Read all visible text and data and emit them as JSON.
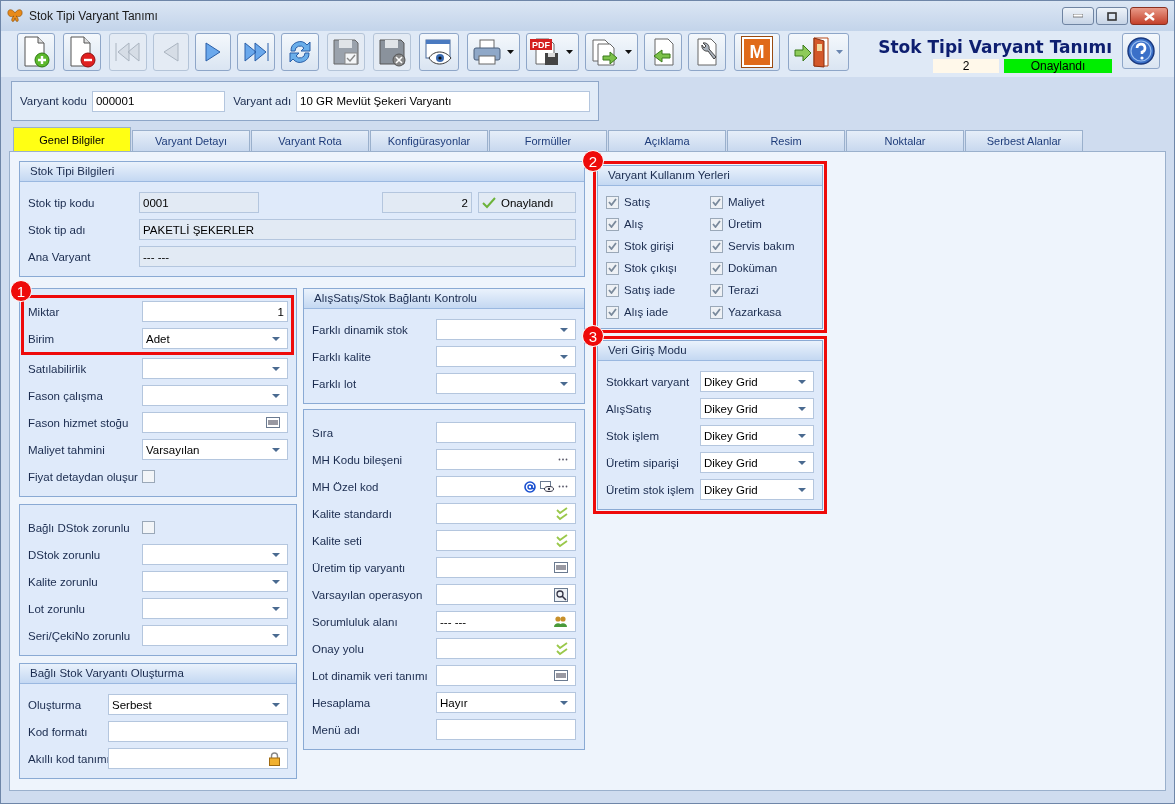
{
  "window": {
    "title": "Stok Tipi Varyant Tanımı"
  },
  "toolbar": [
    [
      {
        "disabled": false
      }
    ],
    [
      {
        "disabled": false
      }
    ],
    [
      {
        "disabled": true
      },
      {
        "disabled": true
      },
      {
        "disabled": false
      },
      {
        "disabled": false
      },
      {
        "disabled": false
      }
    ],
    [
      {
        "disabled": true
      }
    ],
    [
      {
        "disabled": true
      }
    ],
    [
      {
        "disabled": false
      }
    ],
    [
      {
        "disabled": false,
        "menu": true
      },
      {
        "label": "PDF",
        "disabled": false,
        "menu": true
      },
      {
        "disabled": false,
        "menu": true
      },
      {
        "disabled": false
      },
      {
        "disabled": false
      }
    ],
    [
      {
        "label": "M",
        "disabled": false
      }
    ],
    [
      {
        "disabled": false,
        "menu": true
      }
    ]
  ],
  "header": {
    "title": "Stok Tipi Varyant Tanımı",
    "number": "2",
    "status": "Onaylandı",
    "approved": true
  },
  "variant": {
    "code_label": "Varyant kodu",
    "code": "000001",
    "name_label": "Varyant adı",
    "name": "10 GR Mevlüt Şekeri Varyantı"
  },
  "tabs": [
    {
      "label": "Genel Bilgiler",
      "selected": true
    },
    {
      "label": "Varyant Detayı",
      "selected": false
    },
    {
      "label": "Varyant Rota",
      "selected": false
    },
    {
      "label": "Konfigürasyonlar",
      "selected": false
    },
    {
      "label": "Formüller",
      "selected": false
    },
    {
      "label": "Açıklama",
      "selected": false
    },
    {
      "label": "Resim",
      "selected": false
    },
    {
      "label": "Noktalar",
      "selected": false
    },
    {
      "label": "Serbest Alanlar",
      "selected": false
    }
  ],
  "stock_type_panel": {
    "title": "Stok Tipi Bilgileri",
    "code_label": "Stok tip kodu",
    "code": "0001",
    "number": "2",
    "status": "Onaylandı",
    "name_label": "Stok tip adı",
    "name": "PAKETLİ ŞEKERLER",
    "parent_label": "Ana Varyant",
    "parent": "--- ---"
  },
  "columns": [
    [
      {
        "kind": "fields",
        "groups": [
          {
            "annotation": "1",
            "fields": [
              {
                "label": "Miktar",
                "kind": "number",
                "value": "1"
              },
              {
                "label": "Birim",
                "kind": "dropdown",
                "value": "Adet"
              }
            ]
          },
          {
            "fields": [
              {
                "label": "Satılabilirlik",
                "kind": "dropdown"
              },
              {
                "label": "Fason çalışma",
                "kind": "dropdown"
              },
              {
                "label": "Fason hizmet stoğu",
                "kind": "barcode"
              },
              {
                "label": "Maliyet tahmini",
                "kind": "dropdown",
                "value": "Varsayılan"
              },
              {
                "label": "Fiyat detaydan oluşur",
                "kind": "checkbox",
                "checked": false
              }
            ]
          }
        ]
      },
      {
        "kind": "fields",
        "groups": [
          {
            "fields": [
              {
                "label": "Bağlı DStok zorunlu",
                "kind": "checkbox",
                "checked": false
              },
              {
                "label": "DStok zorunlu",
                "kind": "dropdown"
              },
              {
                "label": "Kalite zorunlu",
                "kind": "dropdown"
              },
              {
                "label": "Lot zorunlu",
                "kind": "dropdown"
              },
              {
                "label": "Seri/ÇekiNo zorunlu",
                "kind": "dropdown"
              }
            ]
          }
        ]
      },
      {
        "kind": "fields",
        "title": "Bağlı Stok Varyantı Oluşturma",
        "groups": [
          {
            "fields": [
              {
                "label": "Oluşturma",
                "kind": "dropdown",
                "value": "Serbest"
              },
              {
                "label": "Kod formatı",
                "kind": "text"
              },
              {
                "label": "Akıllı kod tanımı",
                "kind": "lock"
              }
            ]
          }
        ]
      }
    ],
    [
      {
        "kind": "fields",
        "title": "AlışSatış/Stok Bağlantı Kontrolu",
        "groups": [
          {
            "fields": [
              {
                "label": "Farklı dinamik stok",
                "kind": "dropdown"
              },
              {
                "label": "Farklı kalite",
                "kind": "dropdown"
              },
              {
                "label": "Farklı lot",
                "kind": "dropdown"
              }
            ]
          }
        ]
      },
      {
        "kind": "fields",
        "groups": [
          {
            "fields": [
              {
                "label": "Sıra",
                "kind": "text"
              },
              {
                "label": "MH Kodu bileşeni",
                "kind": "dots"
              },
              {
                "label": "MH Özel kod",
                "kind": "special"
              },
              {
                "label": "Kalite standardı",
                "kind": "check"
              },
              {
                "label": "Kalite seti",
                "kind": "check"
              },
              {
                "label": "Üretim tip varyantı",
                "kind": "barcode"
              },
              {
                "label": "Varsayılan operasyon",
                "kind": "search"
              },
              {
                "label": "Sorumluluk alanı",
                "kind": "people",
                "value": "--- ---"
              },
              {
                "label": "Onay yolu",
                "kind": "check"
              },
              {
                "label": "Lot dinamik veri tanımı",
                "kind": "barcode"
              },
              {
                "label": "Hesaplama",
                "kind": "dropdown",
                "value": "Hayır"
              },
              {
                "label": "Menü adı",
                "kind": "text"
              }
            ]
          }
        ]
      }
    ],
    [
      {
        "kind": "checks",
        "title": "Varyant Kullanım Yerleri",
        "annotation": "2",
        "items": [
          {
            "label": "Satış",
            "checked": true
          },
          {
            "label": "Alış",
            "checked": true
          },
          {
            "label": "Stok girişi",
            "checked": true
          },
          {
            "label": "Stok çıkışı",
            "checked": true
          },
          {
            "label": "Satış iade",
            "checked": true
          },
          {
            "label": "Alış iade",
            "checked": true
          },
          {
            "label": "Maliyet",
            "checked": true
          },
          {
            "label": "Üretim",
            "checked": true
          },
          {
            "label": "Servis bakım",
            "checked": true
          },
          {
            "label": "Doküman",
            "checked": true
          },
          {
            "label": "Terazi",
            "checked": true
          },
          {
            "label": "Yazarkasa",
            "checked": true
          }
        ]
      },
      {
        "kind": "fields",
        "title": "Veri Giriş Modu",
        "annotation": "3",
        "groups": [
          {
            "fields": [
              {
                "label": "Stokkart varyant",
                "kind": "dropdown",
                "value": "Dikey Grid"
              },
              {
                "label": "AlışSatış",
                "kind": "dropdown",
                "value": "Dikey Grid"
              },
              {
                "label": "Stok işlem",
                "kind": "dropdown",
                "value": "Dikey Grid"
              },
              {
                "label": "Üretim siparişi",
                "kind": "dropdown",
                "value": "Dikey Grid"
              },
              {
                "label": "Üretim stok işlem",
                "kind": "dropdown",
                "value": "Dikey Grid"
              }
            ]
          }
        ]
      }
    ]
  ]
}
